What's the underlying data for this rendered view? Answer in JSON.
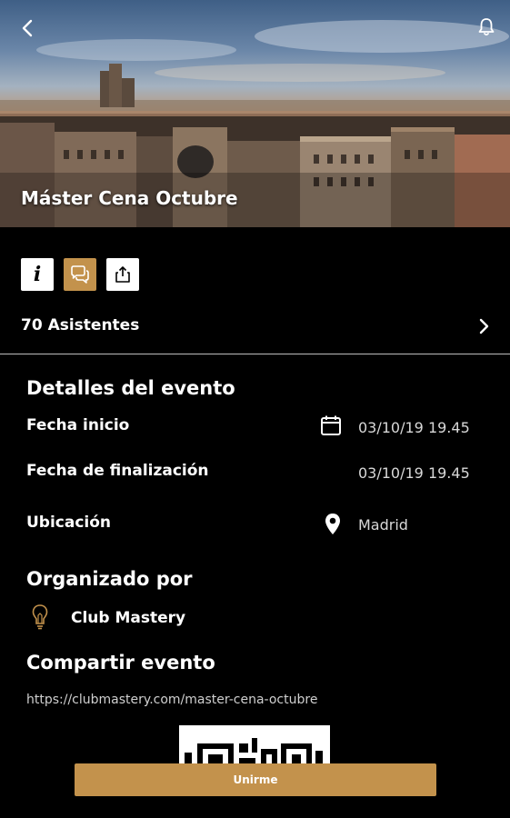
{
  "event": {
    "title": "Máster Cena Octubre",
    "attendees_label": "70 Asistentes"
  },
  "details": {
    "section_title": "Detalles del evento",
    "start_label": "Fecha inicio",
    "start_value": "03/10/19 19.45",
    "end_label": "Fecha de finalización",
    "end_value": "03/10/19 19.45",
    "location_label": "Ubicación",
    "location_value": "Madrid"
  },
  "organizer": {
    "section_title": "Organizado por",
    "name": "Club Mastery"
  },
  "share": {
    "section_title": "Compartir evento",
    "url": "https://clubmastery.com/master-cena-octubre"
  },
  "join_button": "Unirme",
  "icons": [
    "back-arrow-icon",
    "bell-icon",
    "info-icon",
    "chat-icon",
    "share-icon",
    "chevron-right-icon",
    "calendar-icon",
    "location-pin-icon",
    "lightbulb-icon"
  ],
  "colors": {
    "accent": "#c3924c",
    "background": "#000000",
    "divider": "#bdbdbd"
  }
}
